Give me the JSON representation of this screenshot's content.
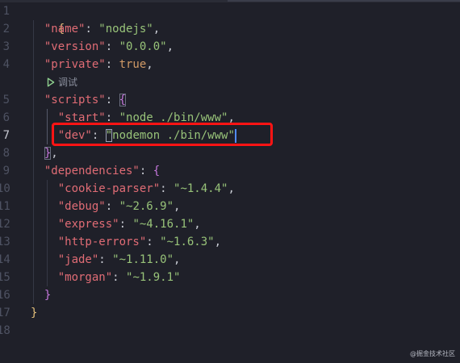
{
  "editor": {
    "active_line": 7,
    "colors": {
      "background": "#1f2029",
      "key": "#e06c75",
      "string": "#98c379",
      "literal": "#d19a66",
      "outer_brace": "#e5c07b",
      "inner_brace": "#c678dd",
      "highlight_box": "#ff1414"
    },
    "codelens": {
      "icon": "play-icon",
      "label": "调试"
    },
    "line_numbers": [
      "1",
      "2",
      "3",
      "4",
      "5",
      "6",
      "7",
      "8",
      "9",
      "10",
      "11",
      "12",
      "13",
      "14",
      "15",
      "16",
      "17",
      "18"
    ],
    "lines": {
      "l1": {
        "open": "{"
      },
      "l2": {
        "key": "\"name\"",
        "colon": ": ",
        "value": "\"nodejs\"",
        "comma": ","
      },
      "l3": {
        "key": "\"version\"",
        "colon": ": ",
        "value": "\"0.0.0\"",
        "comma": ","
      },
      "l4": {
        "key": "\"private\"",
        "colon": ": ",
        "value": "true",
        "comma": ","
      },
      "l5": {
        "key": "\"scripts\"",
        "colon": ": ",
        "open": "{"
      },
      "l6": {
        "key": "\"start\"",
        "colon": ": ",
        "value": "\"node ./bin/www\"",
        "comma": ","
      },
      "l7": {
        "key": "\"dev\"",
        "colon": ": ",
        "quote_open": "\"",
        "value_inner": "nodemon ./bin/www",
        "quote_close": "\""
      },
      "l8": {
        "close": "}",
        "comma": ","
      },
      "l9": {
        "key": "\"dependencies\"",
        "colon": ": ",
        "open": "{"
      },
      "l10": {
        "key": "\"cookie-parser\"",
        "colon": ": ",
        "value": "\"~1.4.4\"",
        "comma": ","
      },
      "l11": {
        "key": "\"debug\"",
        "colon": ": ",
        "value": "\"~2.6.9\"",
        "comma": ","
      },
      "l12": {
        "key": "\"express\"",
        "colon": ": ",
        "value": "\"~4.16.1\"",
        "comma": ","
      },
      "l13": {
        "key": "\"http-errors\"",
        "colon": ": ",
        "value": "\"~1.6.3\"",
        "comma": ","
      },
      "l14": {
        "key": "\"jade\"",
        "colon": ": ",
        "value": "\"~1.11.0\"",
        "comma": ","
      },
      "l15": {
        "key": "\"morgan\"",
        "colon": ": ",
        "value": "\"~1.9.1\""
      },
      "l16": {
        "close": "}"
      },
      "l17": {
        "close": "}"
      }
    }
  },
  "watermark": "@掘金技术社区"
}
